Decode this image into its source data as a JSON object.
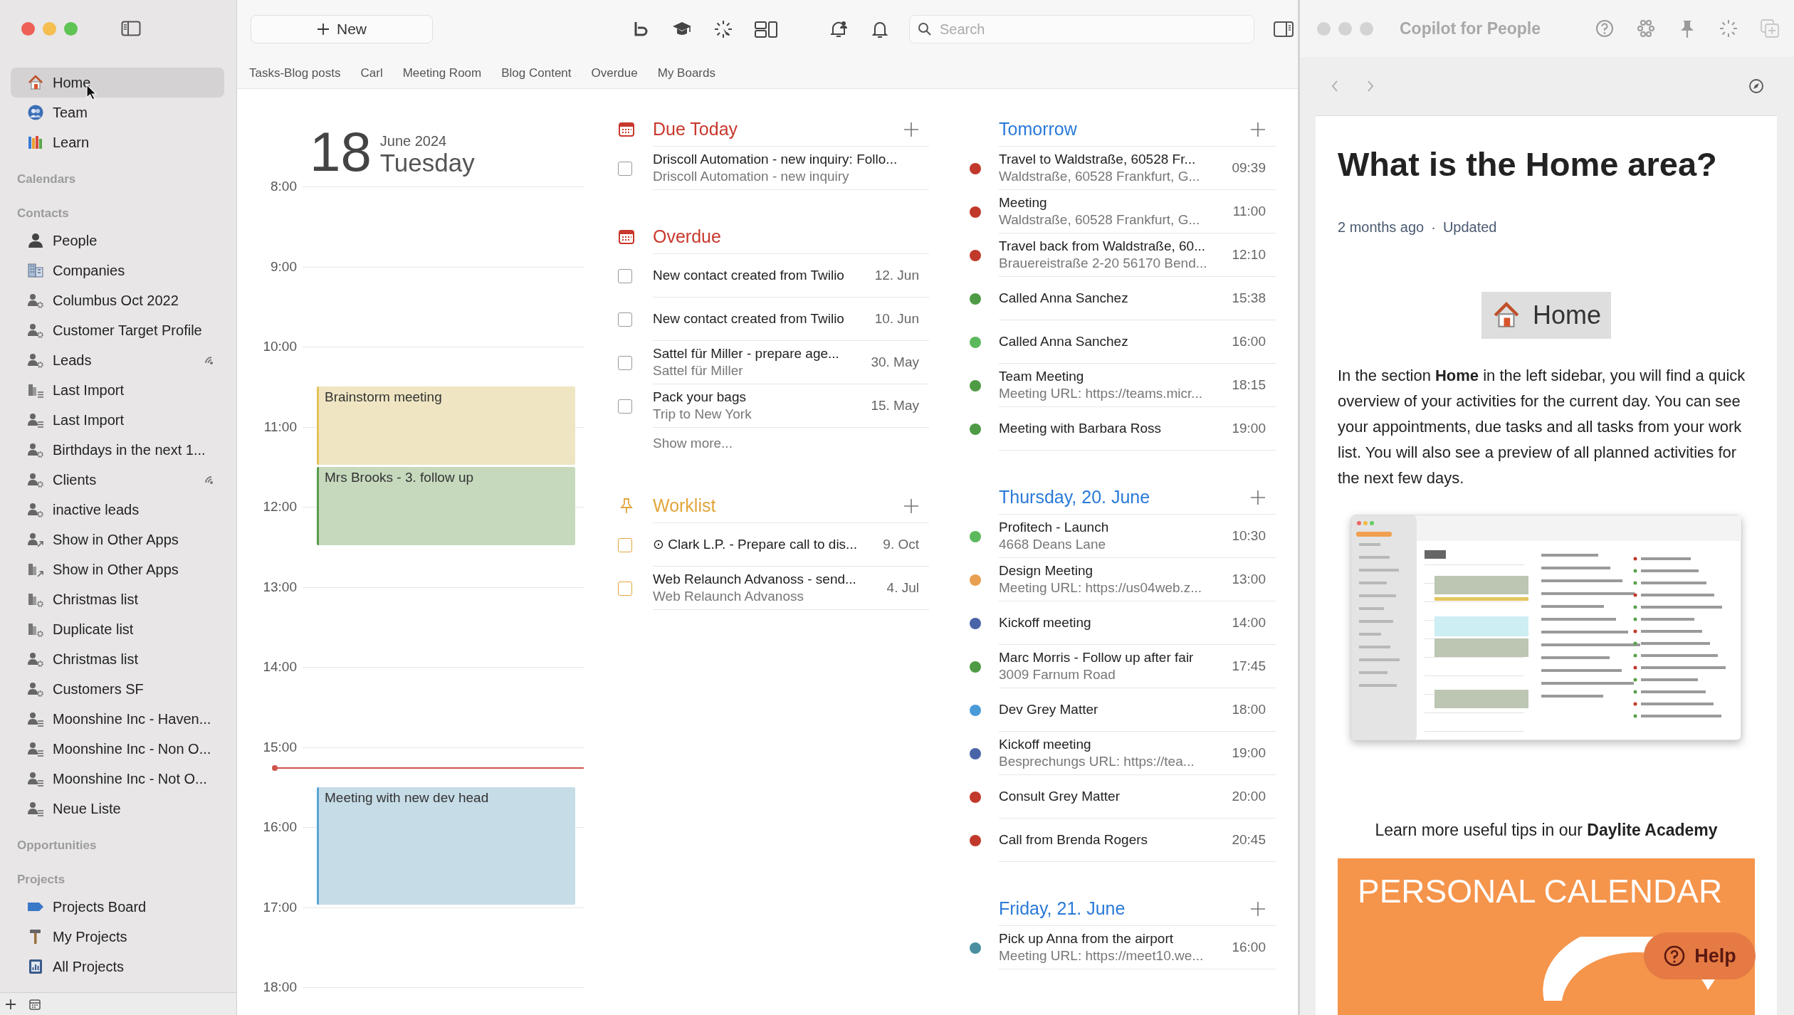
{
  "sidebar": {
    "top_items": [
      {
        "label": "Home",
        "kind": "home",
        "selected": true
      },
      {
        "label": "Team",
        "kind": "team",
        "selected": false
      },
      {
        "label": "Learn",
        "kind": "learn",
        "selected": false
      }
    ],
    "sections": [
      {
        "title": "Calendars"
      },
      {
        "title": "Contacts",
        "items": [
          {
            "label": "People",
            "kind": "person",
            "selected": false,
            "synced": false
          },
          {
            "label": "Companies",
            "kind": "company",
            "selected": false,
            "synced": false
          },
          {
            "label": "Columbus Oct 2022",
            "kind": "smartperson",
            "selected": false,
            "synced": false
          },
          {
            "label": "Customer Target Profile",
            "kind": "smartperson",
            "selected": false,
            "synced": false
          },
          {
            "label": "Leads",
            "kind": "smartperson",
            "selected": false,
            "synced": true
          },
          {
            "label": "Last Import",
            "kind": "listcompany",
            "selected": false,
            "synced": false
          },
          {
            "label": "Last Import",
            "kind": "listperson",
            "selected": false,
            "synced": false
          },
          {
            "label": "Birthdays in the next 1...",
            "kind": "smartperson",
            "selected": false,
            "synced": false
          },
          {
            "label": "Clients",
            "kind": "smartperson",
            "selected": false,
            "synced": true
          },
          {
            "label": "inactive leads",
            "kind": "smartperson",
            "selected": false,
            "synced": false
          },
          {
            "label": "Show in Other Apps",
            "kind": "sharedperson",
            "selected": false,
            "synced": false
          },
          {
            "label": "Show in Other Apps",
            "kind": "sharedcompany",
            "selected": false,
            "synced": false
          },
          {
            "label": "Christmas list",
            "kind": "smartcompany",
            "selected": false,
            "synced": false
          },
          {
            "label": "Duplicate list",
            "kind": "smartcompany",
            "selected": false,
            "synced": false
          },
          {
            "label": "Christmas list",
            "kind": "smartperson",
            "selected": false,
            "synced": false
          },
          {
            "label": "Customers SF",
            "kind": "smartperson",
            "selected": false,
            "synced": false
          },
          {
            "label": "Moonshine Inc - Haven...",
            "kind": "listperson",
            "selected": false,
            "synced": false
          },
          {
            "label": "Moonshine Inc - Non O...",
            "kind": "listperson",
            "selected": false,
            "synced": false
          },
          {
            "label": "Moonshine Inc - Not O...",
            "kind": "listperson",
            "selected": false,
            "synced": false
          },
          {
            "label": "Neue Liste",
            "kind": "listperson",
            "selected": false,
            "synced": false
          }
        ]
      },
      {
        "title": "Opportunities"
      },
      {
        "title": "Projects",
        "items": [
          {
            "label": "Projects Board",
            "kind": "board",
            "selected": false
          },
          {
            "label": "My Projects",
            "kind": "tools",
            "selected": false
          },
          {
            "label": "All Projects",
            "kind": "projects",
            "selected": false
          }
        ]
      }
    ]
  },
  "toolbar": {
    "new_button": "New",
    "search": {
      "placeholder": "Search"
    }
  },
  "bookmarks": [
    "Tasks-Blog posts",
    "Carl",
    "Meeting Room",
    "Blog Content",
    "Overdue",
    "My Boards"
  ],
  "calendar": {
    "day": "18",
    "month_year": "June 2024",
    "weekday": "Tuesday",
    "hours": [
      {
        "label": "8:00",
        "now": false
      },
      {
        "label": "9:00",
        "now": false
      },
      {
        "label": "10:00",
        "now": false,
        "events": [
          {
            "title": "Brainstorm meeting",
            "color": "#e2c25a",
            "half_past": true,
            "long": false
          }
        ]
      },
      {
        "label": "11:00",
        "now": false,
        "events": [
          {
            "title": "Mrs Brooks - 3. follow up",
            "color": "#5b9a4b",
            "half_past": true,
            "long": false
          }
        ]
      },
      {
        "label": "12:00",
        "now": false
      },
      {
        "label": "13:00",
        "now": false
      },
      {
        "label": "14:00",
        "now": false
      },
      {
        "label": "15:00",
        "now": true,
        "events": [
          {
            "title": "Meeting with new dev head",
            "color": "#5aa5d6",
            "half_past": true,
            "long": true
          }
        ]
      },
      {
        "label": "16:00",
        "now": false
      },
      {
        "label": "17:00",
        "now": false
      },
      {
        "label": "18:00",
        "now": false
      }
    ]
  },
  "tasks": {
    "sections": [
      {
        "kind": "due",
        "title": "Due Today",
        "color": "#c8382c",
        "can_add": true,
        "items": [
          {
            "title": "Driscoll Automation - new inquiry: Follo...",
            "subtitle": "Driscoll Automation - new inquiry",
            "checked": false
          }
        ]
      },
      {
        "kind": "overdue",
        "title": "Overdue",
        "color": "#c8382c",
        "can_add": false,
        "show_more": "Show more...",
        "items": [
          {
            "title": "New contact created from Twilio",
            "date": "12. Jun",
            "checked": false
          },
          {
            "title": "New contact created from Twilio",
            "date": "10. Jun",
            "checked": false
          },
          {
            "title": "Sattel für Miller - prepare age...",
            "subtitle": "Sattel für Miller",
            "date": "30. May",
            "checked": false
          },
          {
            "title": "Pack your bags",
            "subtitle": "Trip to New York",
            "date": "15. May",
            "checked": false
          }
        ]
      },
      {
        "kind": "worklist",
        "title": "Worklist",
        "color": "#e3a53c",
        "can_add": true,
        "items": [
          {
            "title": "⊙ Clark L.P. - Prepare call to dis...",
            "date": "9. Oct",
            "checked": false
          },
          {
            "title": "Web Relaunch Advanoss - send...",
            "subtitle": "Web Relaunch Advanoss",
            "date": "4. Jul",
            "checked": false
          }
        ]
      }
    ]
  },
  "agenda": {
    "days": [
      {
        "title": "Tomorrow",
        "items": [
          {
            "title": "Travel to Waldstraße, 60528 Fr...",
            "subtitle": "Waldstraße, 60528 Frankfurt, G...",
            "time": "09:39",
            "color": "#c0392b"
          },
          {
            "title": "Meeting",
            "subtitle": "Waldstraße, 60528 Frankfurt, G...",
            "time": "11:00",
            "color": "#c0392b"
          },
          {
            "title": "Travel back from Waldstraße, 60...",
            "subtitle": "Brauereistraße 2-20 56170 Bend...",
            "time": "12:10",
            "color": "#c0392b"
          },
          {
            "title": "Called Anna Sanchez",
            "time": "15:38",
            "color": "#4f9a45"
          },
          {
            "title": "Called Anna Sanchez",
            "time": "16:00",
            "color": "#5cb85c"
          },
          {
            "title": "Team Meeting",
            "subtitle": "Meeting URL: https://teams.micr...",
            "time": "18:15",
            "color": "#4f9a45"
          },
          {
            "title": "Meeting with Barbara Ross",
            "time": "19:00",
            "color": "#4f9a45"
          }
        ]
      },
      {
        "title": "Thursday, 20. June",
        "items": [
          {
            "title": "Profitech - Launch",
            "subtitle": "4668 Deans Lane",
            "time": "10:30",
            "color": "#5cb85c"
          },
          {
            "title": "Design Meeting",
            "subtitle": "Meeting URL: https://us04web.z...",
            "time": "13:00",
            "color": "#e8a050"
          },
          {
            "title": "Kickoff meeting",
            "time": "14:00",
            "color": "#4a64a8"
          },
          {
            "title": "Marc Morris - Follow up after fair",
            "subtitle": "3009 Farnum Road",
            "time": "17:45",
            "color": "#4f9a45"
          },
          {
            "title": "Dev Grey Matter",
            "time": "18:00",
            "color": "#4a9ad8"
          },
          {
            "title": "Kickoff meeting",
            "subtitle": "Besprechungs URL: https://tea...",
            "time": "19:00",
            "color": "#4a64a8"
          },
          {
            "title": "Consult Grey Matter",
            "time": "20:00",
            "color": "#c0392b"
          },
          {
            "title": "Call from Brenda Rogers",
            "time": "20:45",
            "color": "#c0392b"
          }
        ]
      },
      {
        "title": "Friday, 21. June",
        "items": [
          {
            "title": "Pick up Anna from the airport",
            "subtitle": "Meeting URL: https://meet10.we...",
            "time": "16:00",
            "color": "#4a8fa0"
          }
        ]
      }
    ]
  },
  "copilot": {
    "title": "Copilot for People",
    "article": {
      "title": "What is the Home area?",
      "age": "2 months ago",
      "separator": "·",
      "status": "Updated",
      "badge": "Home",
      "body": "In the section **Home** in the left sidebar, you will find a quick overview of your activities for the current day. You can see your appointments, due tasks and all tasks from your work list. You will also see a preview of all planned activities for the next few days.",
      "footer": "Learn more useful tips in our **Daylite Academy**",
      "banner": "PERSONAL CALENDAR"
    },
    "help_button": "Help"
  }
}
